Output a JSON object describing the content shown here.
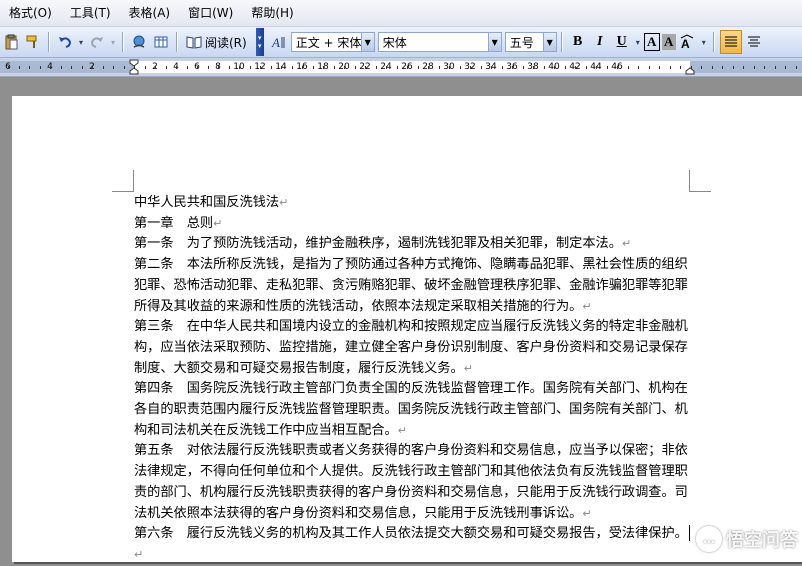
{
  "menu": {
    "items": [
      "格式(O)",
      "工具(T)",
      "表格(A)",
      "窗口(W)",
      "帮助(H)"
    ]
  },
  "toolbar": {
    "read_label": "阅读(R)",
    "style_value": "正文 + 宋体",
    "font_value": "宋体",
    "size_value": "五号",
    "bold_label": "B",
    "italic_label": "I",
    "underline_label": "U",
    "charborder_label": "A",
    "charshade_label": "A"
  },
  "ruler": {
    "left_labels": [
      "8",
      "6",
      "4",
      "2"
    ],
    "right_labels": [
      "2",
      "4",
      "6",
      "8",
      "10",
      "12",
      "14",
      "16",
      "18",
      "20",
      "22",
      "24",
      "26",
      "28",
      "30",
      "32",
      "34",
      "36",
      "38",
      "40",
      "42",
      "44",
      "46"
    ]
  },
  "document": {
    "paragraphs": [
      "中华人民共和国反洗钱法",
      "第一章　总则",
      "第一条　为了预防洗钱活动，维护金融秩序，遏制洗钱犯罪及相关犯罪，制定本法。",
      "第二条　本法所称反洗钱，是指为了预防通过各种方式掩饰、隐瞒毒品犯罪、黑社会性质的组织犯罪、恐怖活动犯罪、走私犯罪、贪污贿赂犯罪、破坏金融管理秩序犯罪、金融诈骗犯罪等犯罪所得及其收益的来源和性质的洗钱活动，依照本法规定采取相关措施的行为。",
      "第三条　在中华人民共和国境内设立的金融机构和按照规定应当履行反洗钱义务的特定非金融机构，应当依法采取预防、监控措施，建立健全客户身份识别制度、客户身份资料和交易记录保存制度、大额交易和可疑交易报告制度，履行反洗钱义务。",
      "第四条　国务院反洗钱行政主管部门负责全国的反洗钱监督管理工作。国务院有关部门、机构在各自的职责范围内履行反洗钱监督管理职责。国务院反洗钱行政主管部门、国务院有关部门、机构和司法机关在反洗钱工作中应当相互配合。",
      "第五条　对依法履行反洗钱职责或者义务获得的客户身份资料和交易信息，应当予以保密；非依法律规定，不得向任何单位和个人提供。反洗钱行政主管部门和其他依法负有反洗钱监督管理职责的部门、机构履行反洗钱职责获得的客户身份资料和交易信息，只能用于反洗钱行政调查。司法机关依照本法获得的客户身份资料和交易信息，只能用于反洗钱刑事诉讼。",
      "第六条　履行反洗钱义务的机构及其工作人员依法提交大额交易和可疑交易报告，受法律保护。"
    ]
  },
  "watermark": {
    "text": "悟空问答"
  }
}
